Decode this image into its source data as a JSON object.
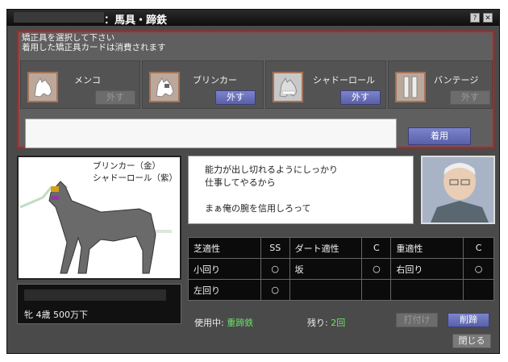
{
  "window": {
    "title": "：馬具・蹄鉄",
    "help_icon": "?",
    "close_icon": "✕"
  },
  "instructions": {
    "line1": "矯正具を選択して下さい",
    "line2": "着用した矯正具カードは消費されます"
  },
  "slots": [
    {
      "label": "メンコ",
      "button": "外す",
      "enabled": false
    },
    {
      "label": "ブリンカー",
      "button": "外す",
      "enabled": true
    },
    {
      "label": "シャドーロール",
      "button": "外す",
      "enabled": true
    },
    {
      "label": "バンテージ",
      "button": "外す",
      "enabled": false
    }
  ],
  "wear_button": "着用",
  "horse": {
    "equip_line1": "ブリンカー（金）",
    "equip_line2": "シャドーロール（紫）",
    "info": "牝 4歳 500万下"
  },
  "speech": {
    "line1": "能力が出し切れるようにしっかり",
    "line2": "仕事してやるから",
    "line3": "まぁ俺の腕を信用しろって"
  },
  "stats": {
    "rows": [
      [
        {
          "label": "芝適性",
          "value": "SS"
        },
        {
          "label": "ダート適性",
          "value": "C"
        },
        {
          "label": "重適性",
          "value": "C"
        }
      ],
      [
        {
          "label": "小回り",
          "value": "○"
        },
        {
          "label": "坂",
          "value": "○"
        },
        {
          "label": "右回り",
          "value": "○"
        }
      ],
      [
        {
          "label": "左回り",
          "value": "○"
        },
        {
          "label": "",
          "value": ""
        },
        {
          "label": "",
          "value": ""
        }
      ]
    ]
  },
  "footer": {
    "in_use_label": "使用中:",
    "in_use_value": "重蹄鉄",
    "remaining_label": "残り:",
    "remaining_value": "2回",
    "attach_button": "打付け",
    "remove_button": "削蹄",
    "close_button": "閉じる"
  },
  "colors": {
    "highlight_border": "#d01818",
    "button_active": "#6a72bc",
    "green_text": "#6ee06e"
  }
}
